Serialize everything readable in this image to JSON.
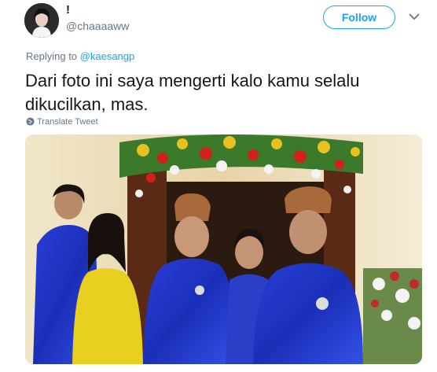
{
  "author": {
    "display_name": "!",
    "handle": "@chaaaaww"
  },
  "follow_label": "Follow",
  "reply": {
    "prefix": "Replying to",
    "to": "@kaesangp"
  },
  "tweet_text": "Dari foto ini saya mengerti kalo kamu selalu dikucilkan, mas.",
  "translate_label": "Translate Tweet",
  "colors": {
    "accent": "#1da1f2",
    "secondary_text": "#657786",
    "primary_text": "#14171a"
  },
  "icons": [
    "chevron-down-icon",
    "globe-icon"
  ]
}
